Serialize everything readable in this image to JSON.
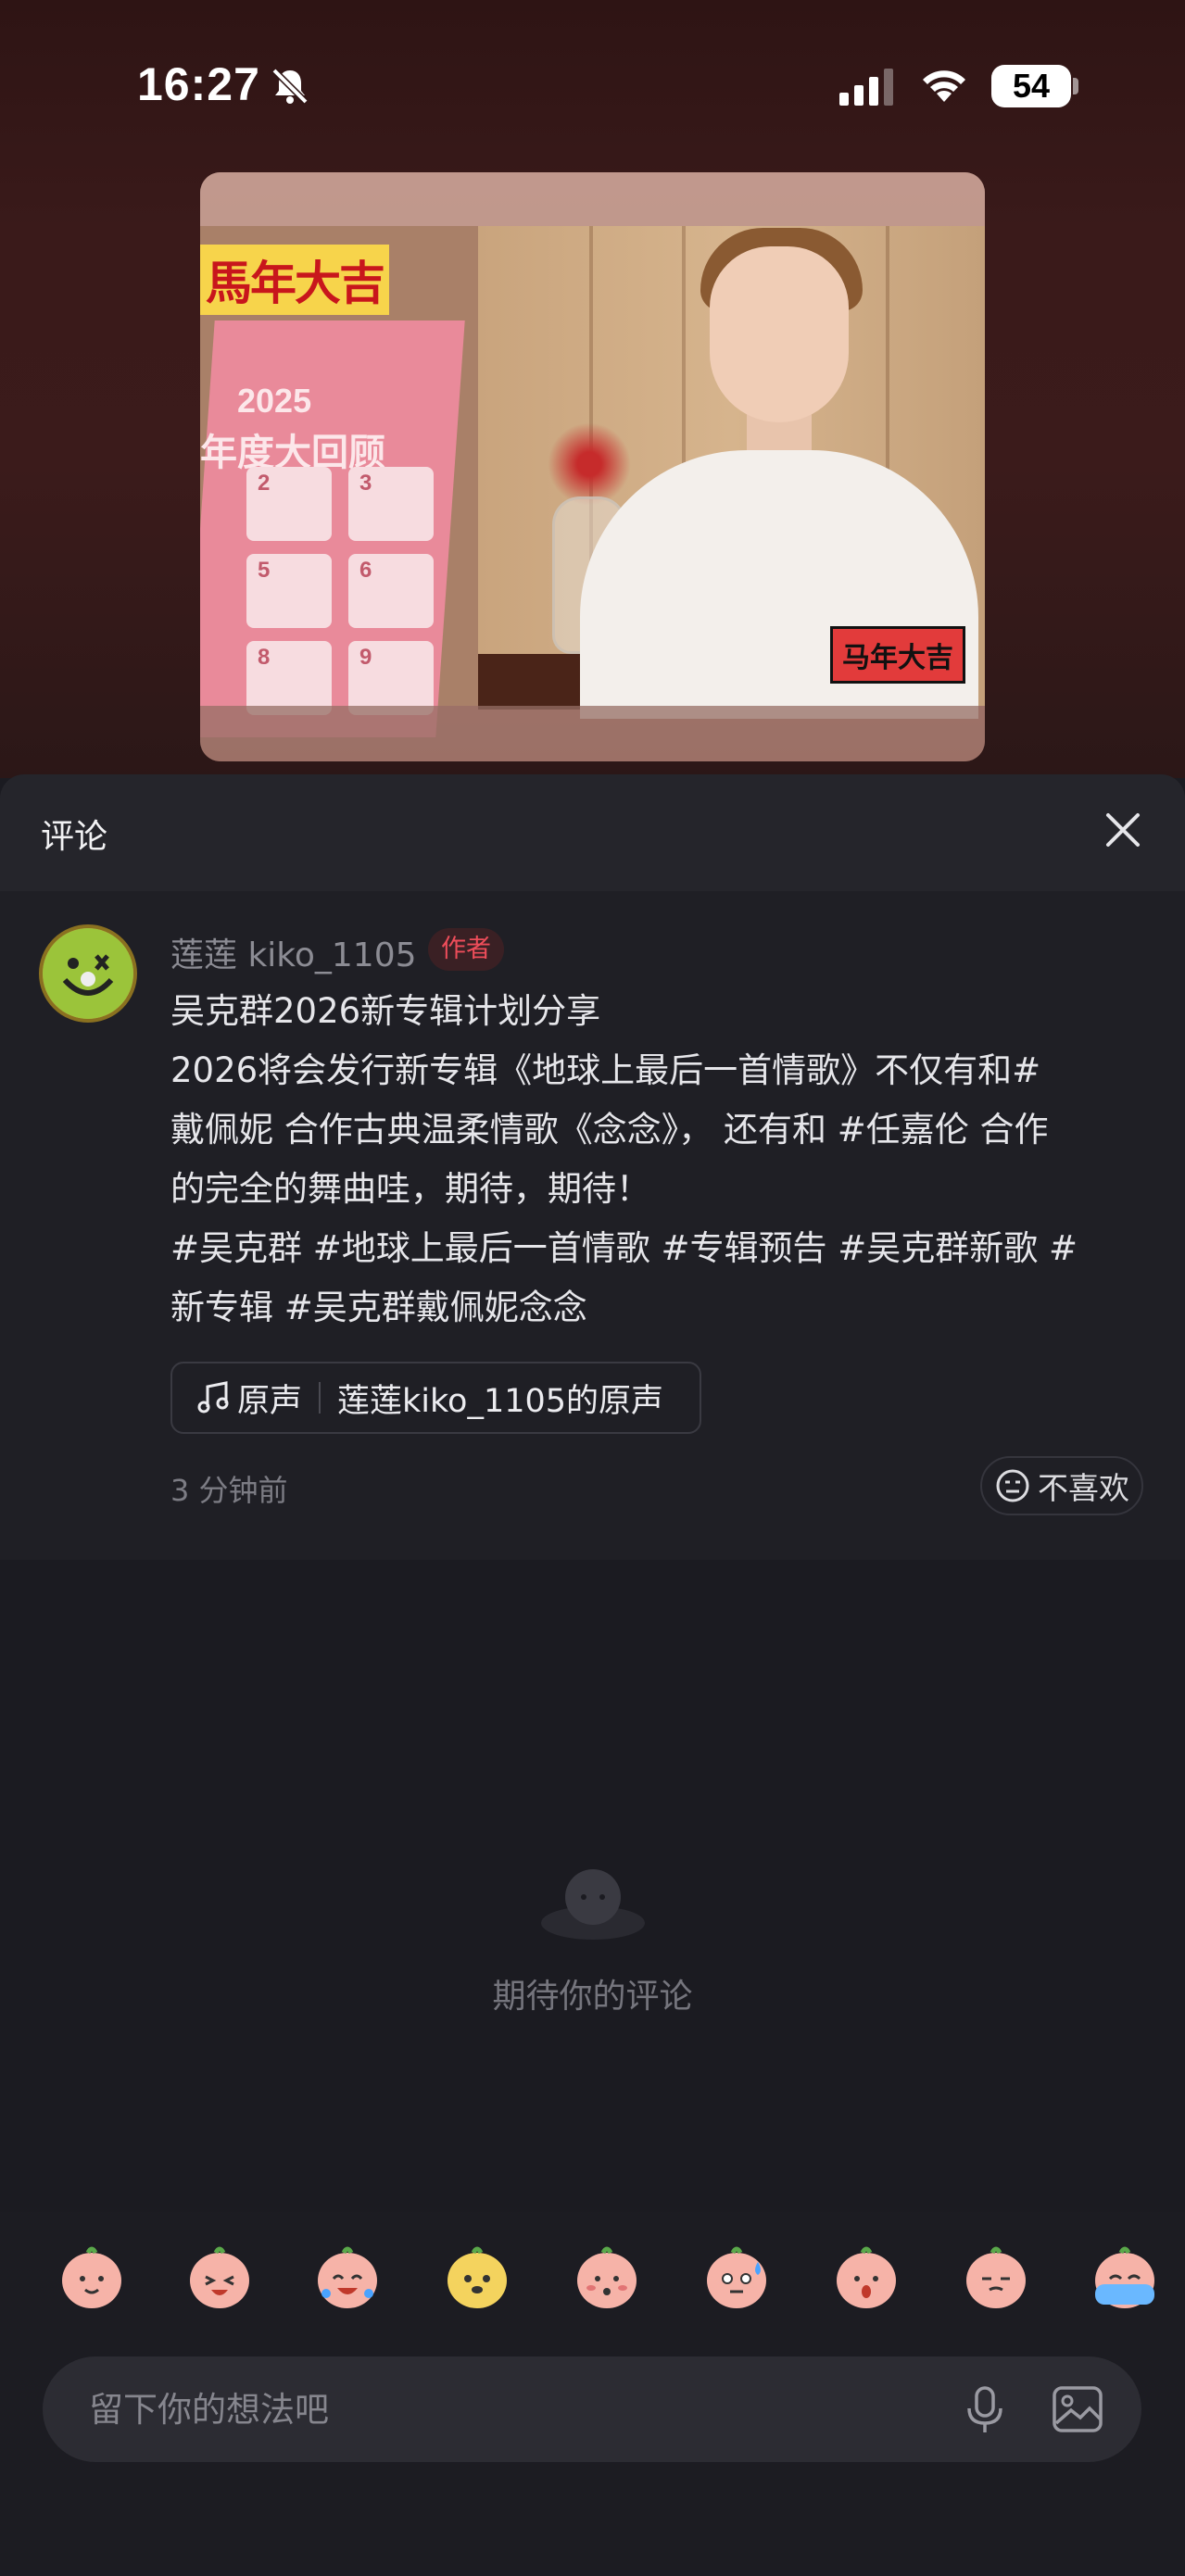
{
  "status_bar": {
    "time": "16:27",
    "battery": "54"
  },
  "video": {
    "badge_top": "馬年大吉",
    "calendar_year": "2025",
    "calendar_title": "年度大回顾",
    "calendar_cells": [
      "2",
      "3",
      "5",
      "6",
      "8",
      "9"
    ],
    "badge_bottom": "马年大吉"
  },
  "sheet": {
    "title": "评论"
  },
  "comment": {
    "author": "莲莲 kiko_1105",
    "author_tag": "作者",
    "lines": [
      "吴克群2026新专辑计划分享",
      "2026将会发行新专辑《地球上最后一首情歌》不仅有和#",
      "戴佩妮 合作古典温柔情歌《念念》， 还有和 #任嘉伦 合作",
      "的完全的舞曲哇，期待，期待！",
      "#吴克群 #地球上最后一首情歌 #专辑预告 #吴克群新歌 #",
      "新专辑 #吴克群戴佩妮念念"
    ],
    "music_label": "原声",
    "music_source": "莲莲kiko_1105的原声",
    "time": "3 分钟前",
    "dislike_label": "不喜欢"
  },
  "empty_state": {
    "text": "期待你的评论"
  },
  "emojis": [
    "smile-emoji",
    "laugh-tears-emoji",
    "cry-laugh-emoji",
    "dog-emoji",
    "shy-emoji",
    "sweat-emoji",
    "surprised-emoji",
    "pick-nose-emoji",
    "crying-emoji"
  ],
  "input": {
    "placeholder": "留下你的想法吧"
  },
  "colors": {
    "background": "#1b1b21",
    "sheet_header": "#25252b",
    "author_tag": "#ee4d5a"
  }
}
